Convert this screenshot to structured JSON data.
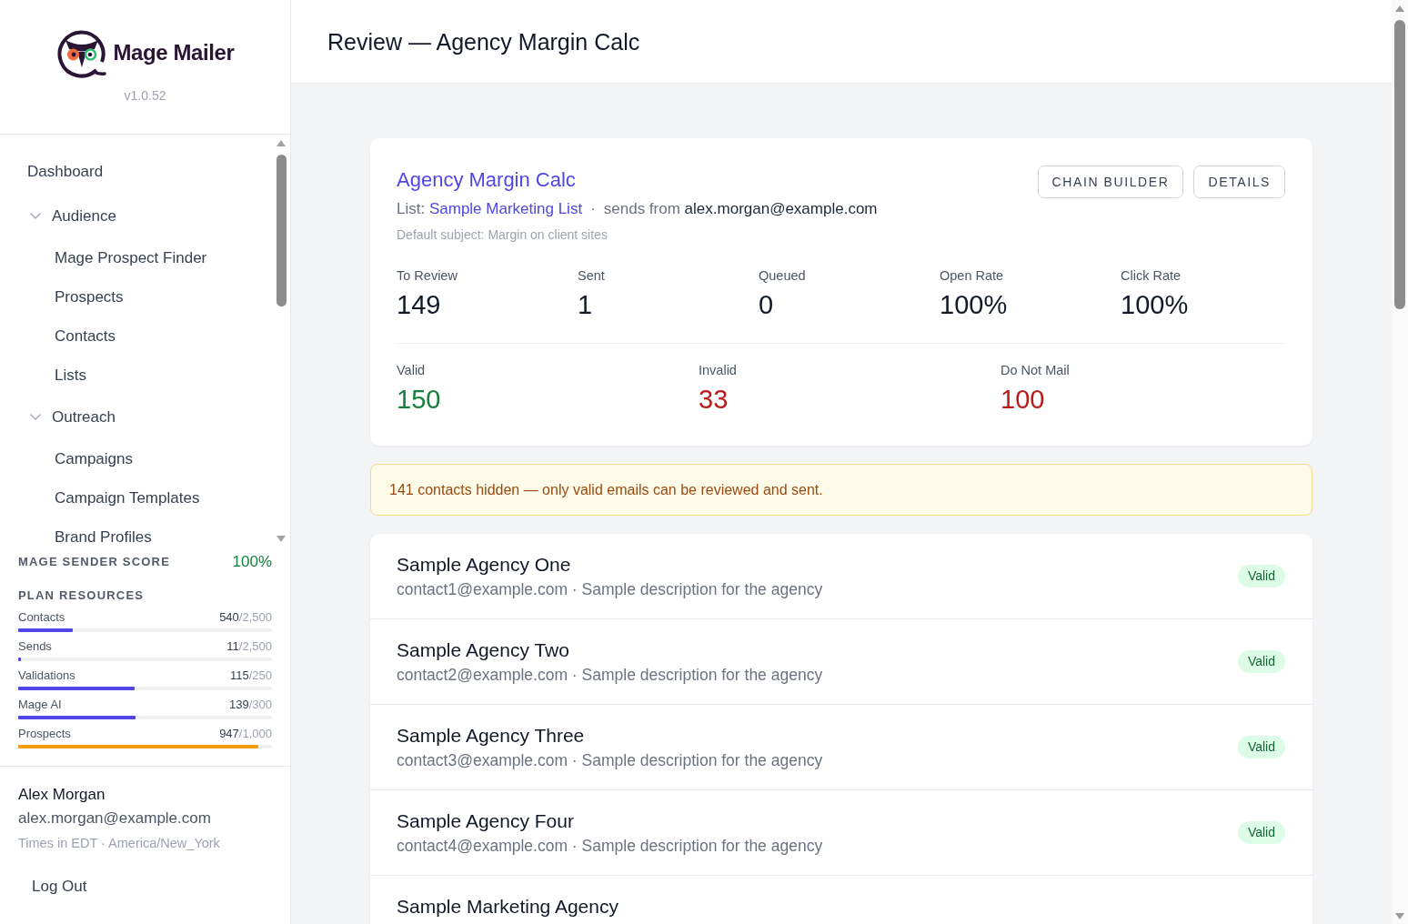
{
  "sidebar": {
    "brand": {
      "name": "Mage Mailer",
      "version": "v1.0.52"
    },
    "nav": [
      {
        "label": "Dashboard"
      },
      {
        "label": "Audience",
        "expanded": true,
        "children": [
          {
            "label": "Mage Prospect Finder"
          },
          {
            "label": "Prospects"
          },
          {
            "label": "Contacts"
          },
          {
            "label": "Lists"
          }
        ]
      },
      {
        "label": "Outreach",
        "expanded": true,
        "children": [
          {
            "label": "Campaigns"
          },
          {
            "label": "Campaign Templates"
          },
          {
            "label": "Brand Profiles"
          }
        ]
      }
    ],
    "sender_score": {
      "label": "MAGE SENDER SCORE",
      "value": "100%"
    },
    "plan_resources": {
      "title": "PLAN RESOURCES",
      "items": [
        {
          "label": "Contacts",
          "used": "540",
          "limit": "/2,500",
          "level": 0.216,
          "color": "#4f46e5"
        },
        {
          "label": "Sends",
          "used": "11",
          "limit": "/2,500",
          "level": 0.0044,
          "color": "#4f46e5"
        },
        {
          "label": "Validations",
          "used": "115",
          "limit": "/250",
          "level": 0.46,
          "color": "#4f46e5"
        },
        {
          "label": "Mage AI",
          "used": "139",
          "limit": "/300",
          "level": 0.463,
          "color": "#4f46e5"
        },
        {
          "label": "Prospects",
          "used": "947",
          "limit": "/1,000",
          "level": 0.947,
          "color": "#f59e0b"
        }
      ]
    },
    "user": {
      "name": "Alex Morgan",
      "email": "alex.morgan@example.com",
      "timezone": "Times in EDT · America/New_York"
    },
    "logout": "Log Out"
  },
  "header": {
    "title": "Review — Agency Margin Calc"
  },
  "campaign": {
    "title": "Agency Margin Calc",
    "list_label": "List:",
    "list_name": "Sample Marketing List",
    "separator": "·",
    "sender_label": "sends from",
    "sender": "alex.morgan@example.com",
    "subject": "Default subject: Margin on client sites",
    "buttons": [
      "CHAIN BUILDER",
      "DETAILS"
    ],
    "stats": [
      {
        "label": "To Review",
        "value": "149"
      },
      {
        "label": "Sent",
        "value": "1"
      },
      {
        "label": "Queued",
        "value": "0"
      },
      {
        "label": "Open Rate",
        "value": "100%"
      },
      {
        "label": "Click Rate",
        "value": "100%"
      }
    ],
    "validation": [
      {
        "label": "Valid",
        "value": "150",
        "color": "#15803d"
      },
      {
        "label": "Invalid",
        "value": "33",
        "color": "#b91c1c"
      },
      {
        "label": "Do Not Mail",
        "value": "100",
        "color": "#b91c1c"
      }
    ]
  },
  "notice": "141 contacts hidden — only valid emails can be reviewed and sent.",
  "contacts": [
    {
      "name": "Sample Agency One",
      "details": "contact1@example.com · Sample description for the agency",
      "status": "Valid"
    },
    {
      "name": "Sample Agency Two",
      "details": "contact2@example.com · Sample description for the agency",
      "status": "Valid"
    },
    {
      "name": "Sample Agency Three",
      "details": "contact3@example.com · Sample description for the agency",
      "status": "Valid"
    },
    {
      "name": "Sample Agency Four",
      "details": "contact4@example.com · Sample description for the agency",
      "status": "Valid"
    },
    {
      "name": "Sample Marketing Agency"
    }
  ]
}
